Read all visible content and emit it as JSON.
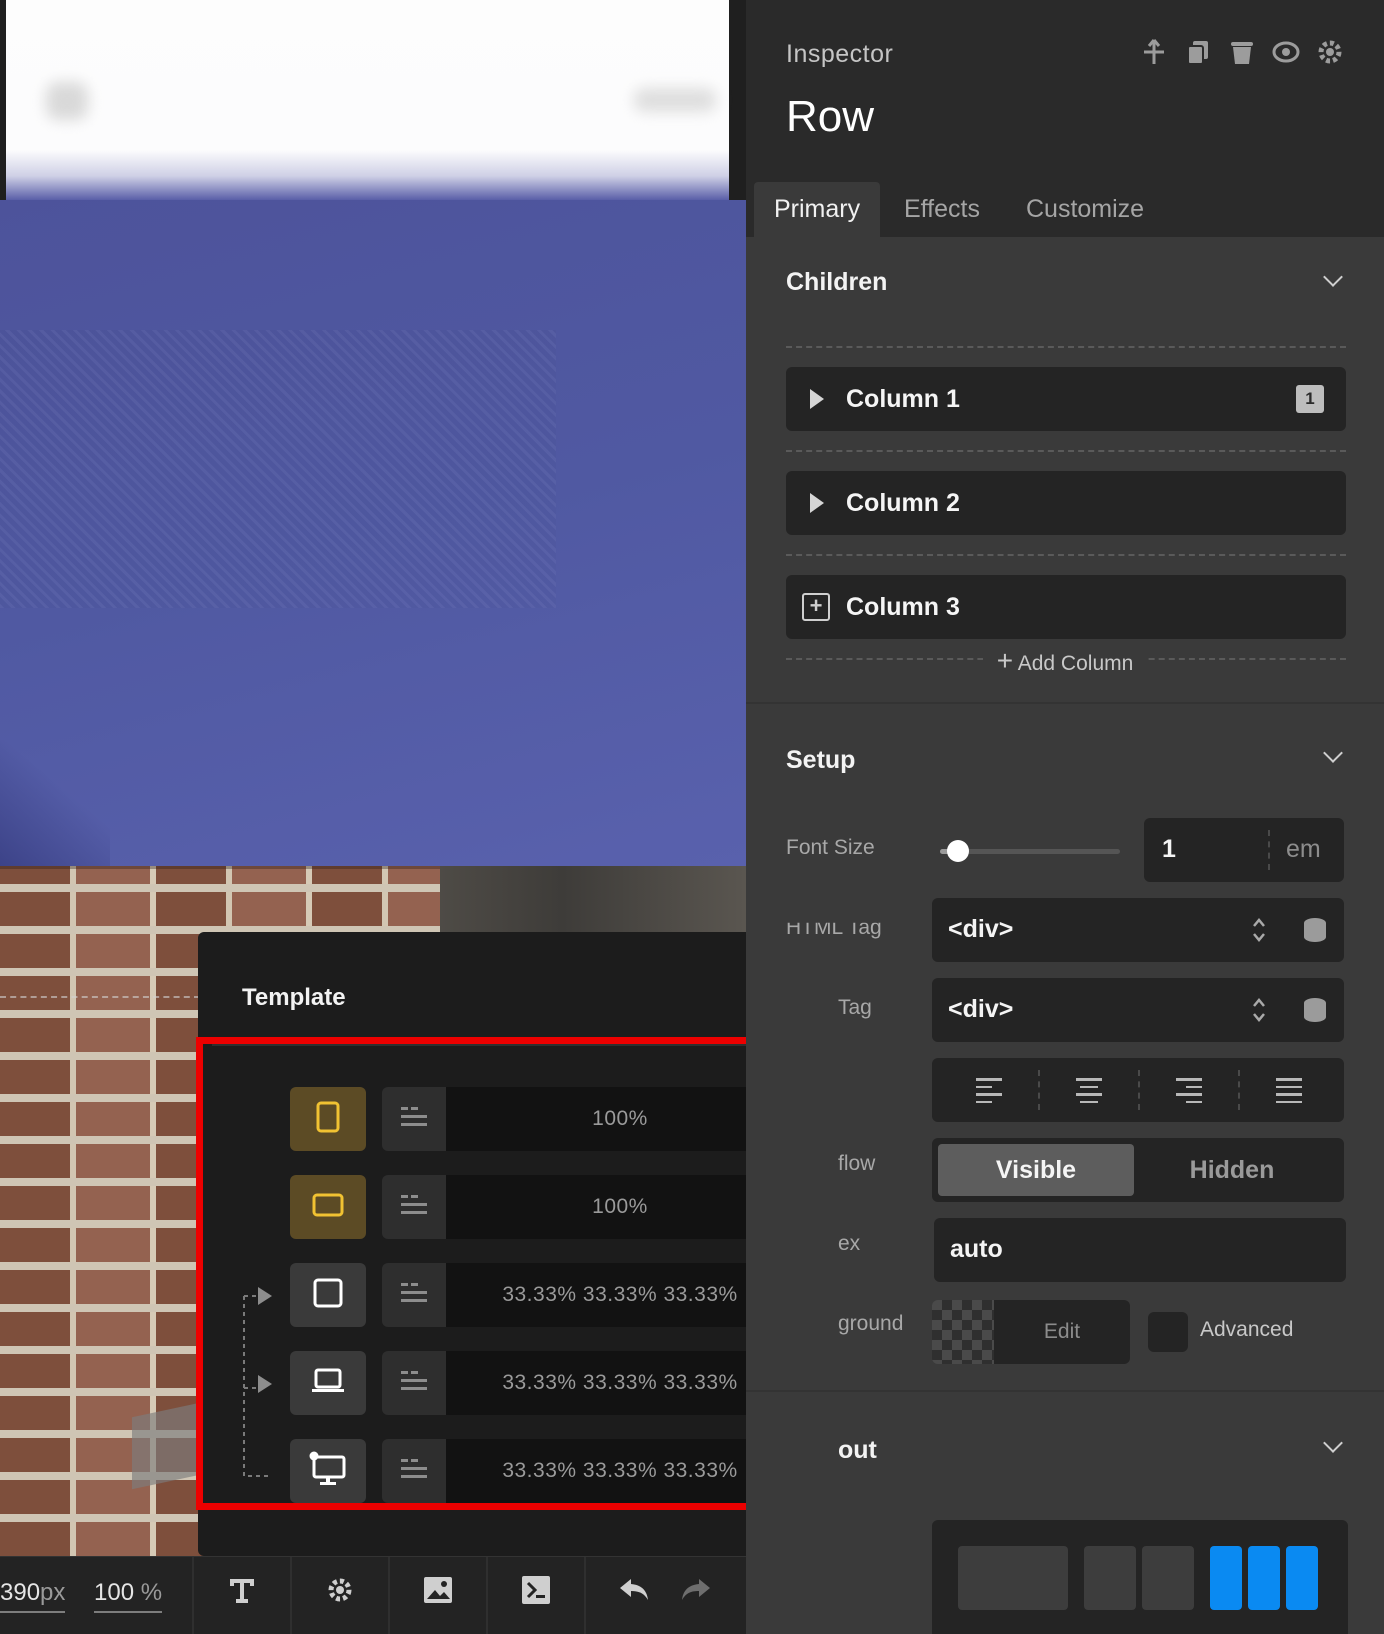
{
  "inspector": {
    "label": "Inspector",
    "title": "Row",
    "header_icons": [
      "anchor-icon",
      "copy-icon",
      "trash-icon",
      "eye-icon",
      "gear-icon"
    ],
    "tabs": [
      {
        "label": "Primary",
        "active": true
      },
      {
        "label": "Effects",
        "active": false
      },
      {
        "label": "Customize",
        "active": false
      }
    ],
    "children": {
      "title": "Children",
      "items": [
        {
          "label": "Column 1",
          "badge": "1",
          "icon": "play-triangle-icon"
        },
        {
          "label": "Column 2",
          "badge": "",
          "icon": "play-triangle-icon"
        },
        {
          "label": "Column 3",
          "badge": "",
          "icon": "plus-square-icon"
        }
      ],
      "add_label": "Add Column"
    },
    "setup": {
      "title": "Setup",
      "font_size_label": "Font Size",
      "font_size_value": "1",
      "font_size_unit": "em",
      "font_size_slider_fraction": 0.1,
      "html_tag_label": "HTML Tag",
      "html_tag_value": "<div>",
      "second_tag_label": "Tag",
      "second_tag_value": "<div>",
      "overflow_label": "flow",
      "overflow_options": [
        "Visible",
        "Hidden"
      ],
      "overflow_selected": "Visible",
      "zindex_label": "ex",
      "zindex_value": "auto",
      "background_label": "ground",
      "background_edit": "Edit",
      "background_advanced": "Advanced"
    },
    "layout": {
      "title": "out"
    }
  },
  "template_popup": {
    "title": "Template",
    "rows": [
      {
        "device": "phone-portrait-icon",
        "active": true,
        "value": "100%"
      },
      {
        "device": "phone-landscape-icon",
        "active": true,
        "value": "100%"
      },
      {
        "device": "tablet-icon",
        "active": false,
        "value": "33.33% 33.33% 33.33%"
      },
      {
        "device": "laptop-icon",
        "active": false,
        "value": "33.33% 33.33% 33.33%"
      },
      {
        "device": "desktop-icon",
        "active": false,
        "value": "33.33% 33.33% 33.33%"
      }
    ],
    "footer_label": "emplate"
  },
  "toolbar": {
    "width_value": "390",
    "width_unit": "px",
    "zoom_value": "100",
    "zoom_unit": "%",
    "icons": [
      "font-icon",
      "gear-icon",
      "image-icon",
      "terminal-icon",
      "undo-icon",
      "redo-icon"
    ]
  },
  "colors": {
    "highlight": "#ec0000",
    "accent_blue": "#0a8af2",
    "active_device": "#5c4b25",
    "active_device_outline": "#f1c232"
  }
}
